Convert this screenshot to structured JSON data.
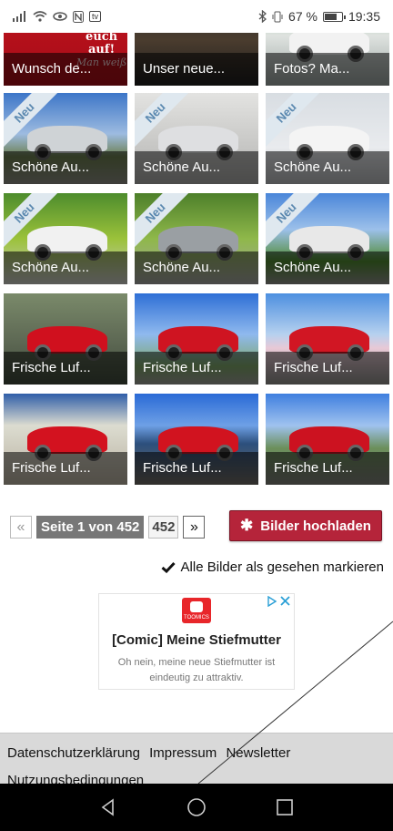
{
  "statusbar": {
    "battery_percent": "67 %",
    "battery_level": 0.67,
    "time": "19:35",
    "icons_left": [
      "signal-icon",
      "wifi-icon",
      "eye-icon",
      "nfc-icon",
      "tv-icon"
    ],
    "icons_right": [
      "bluetooth-icon",
      "vibrate-icon",
      "battery-icon"
    ]
  },
  "gallery": {
    "tiles": [
      {
        "caption": "Wunsch de...",
        "new": false
      },
      {
        "caption": "Unser neue...",
        "new": false
      },
      {
        "caption": "Fotos? Ma...",
        "new": false
      },
      {
        "caption": "Schöne Au...",
        "new": true
      },
      {
        "caption": "Schöne Au...",
        "new": true
      },
      {
        "caption": "Schöne Au...",
        "new": true
      },
      {
        "caption": "Schöne Au...",
        "new": true
      },
      {
        "caption": "Schöne Au...",
        "new": true
      },
      {
        "caption": "Schöne Au...",
        "new": true
      },
      {
        "caption": "Frische Luf...",
        "new": false
      },
      {
        "caption": "Frische Luf...",
        "new": false
      },
      {
        "caption": "Frische Luf...",
        "new": false
      },
      {
        "caption": "Frische Luf...",
        "new": false
      },
      {
        "caption": "Frische Luf...",
        "new": false
      },
      {
        "caption": "Frische Luf...",
        "new": false
      }
    ],
    "tile_top_text": [
      "euch",
      "auf!",
      "Man weiß"
    ],
    "new_badge": "Neu"
  },
  "pagination": {
    "prev": "«",
    "current": "Seite 1 von 452",
    "last": "452",
    "next": "»"
  },
  "upload_button": "Bilder hochladen",
  "mark_seen": "Alle Bilder als gesehen markieren",
  "ad": {
    "brand": "TOOMICS",
    "title": "[Comic] Meine Stiefmutter",
    "text": "Oh nein, meine neue Stiefmutter ist eindeutig zu attraktiv."
  },
  "footer": {
    "links": [
      "Datenschutzerklärung",
      "Impressum",
      "Newsletter",
      "Nutzungsbedingungen"
    ]
  },
  "colors": {
    "accent": "#b5243a",
    "pager_current": "#777777",
    "ribbon_text": "#5b89b0",
    "footer_bg": "#d9d9d9"
  }
}
